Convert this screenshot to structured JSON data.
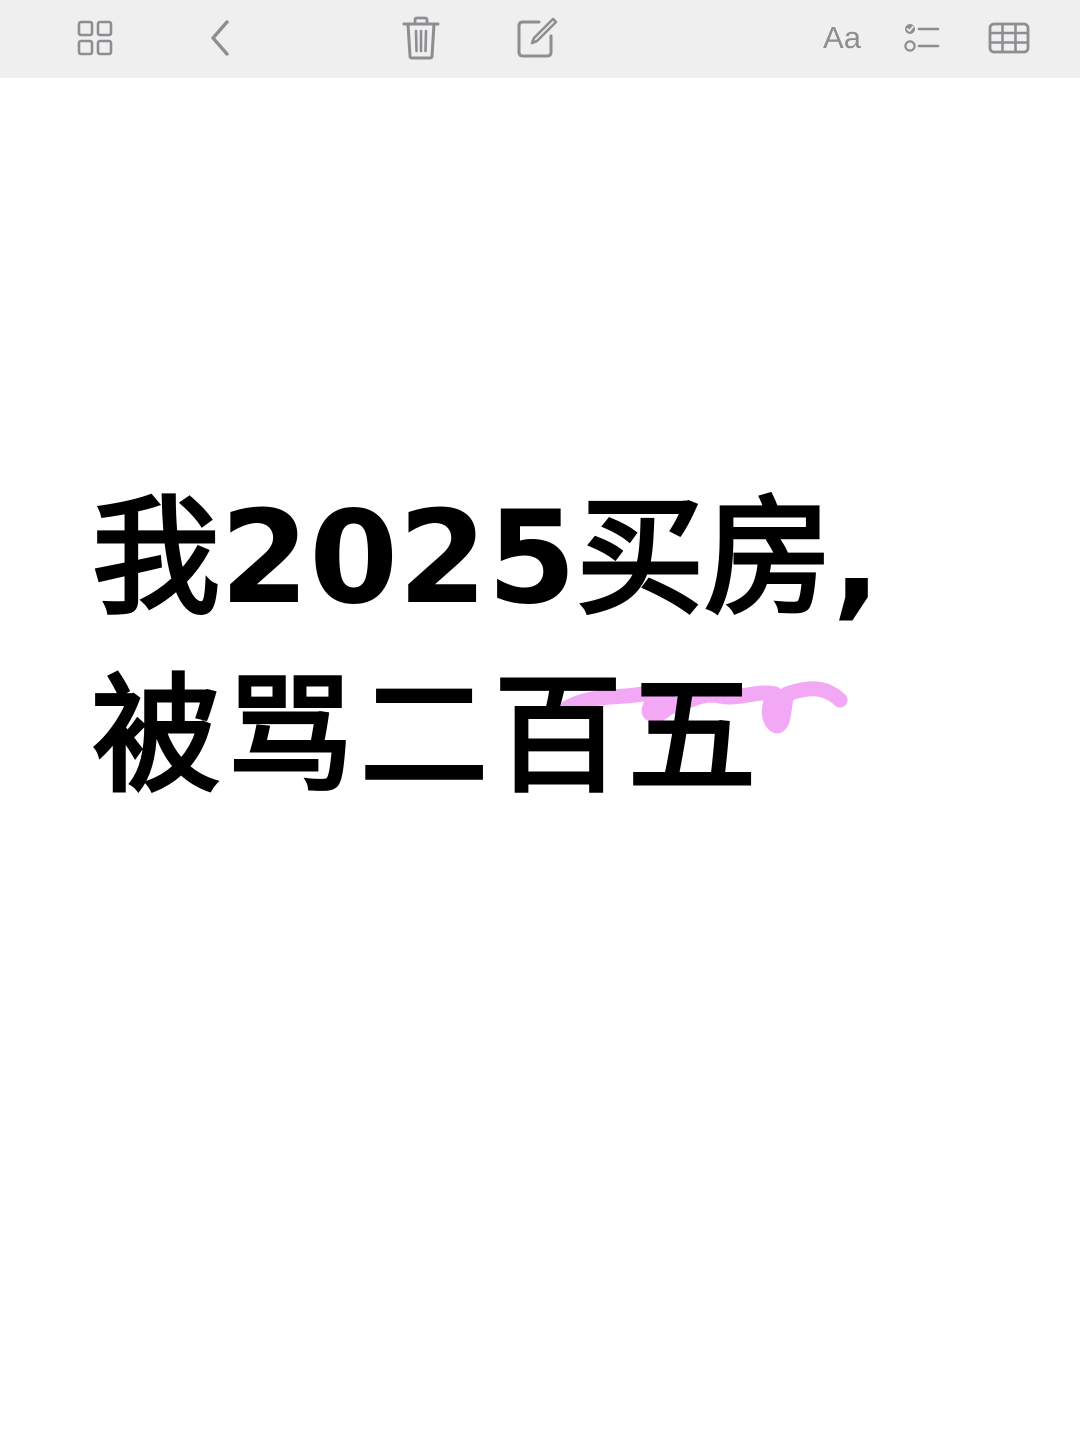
{
  "toolbar": {
    "items": [
      {
        "icon": "grid-view-icon"
      },
      {
        "icon": "chevron-left-icon"
      },
      {
        "icon": "trash-icon"
      },
      {
        "icon": "compose-icon"
      },
      {
        "icon": "text-format-icon",
        "label": "Aa"
      },
      {
        "icon": "checklist-icon"
      },
      {
        "icon": "table-icon"
      }
    ],
    "icon_color": "#8e8e92",
    "background": "#efefef"
  },
  "note": {
    "line1": "我2025买房,",
    "line2": "被骂二百五",
    "text_color": "#000000",
    "highlight_color": "#f2a8f4"
  }
}
